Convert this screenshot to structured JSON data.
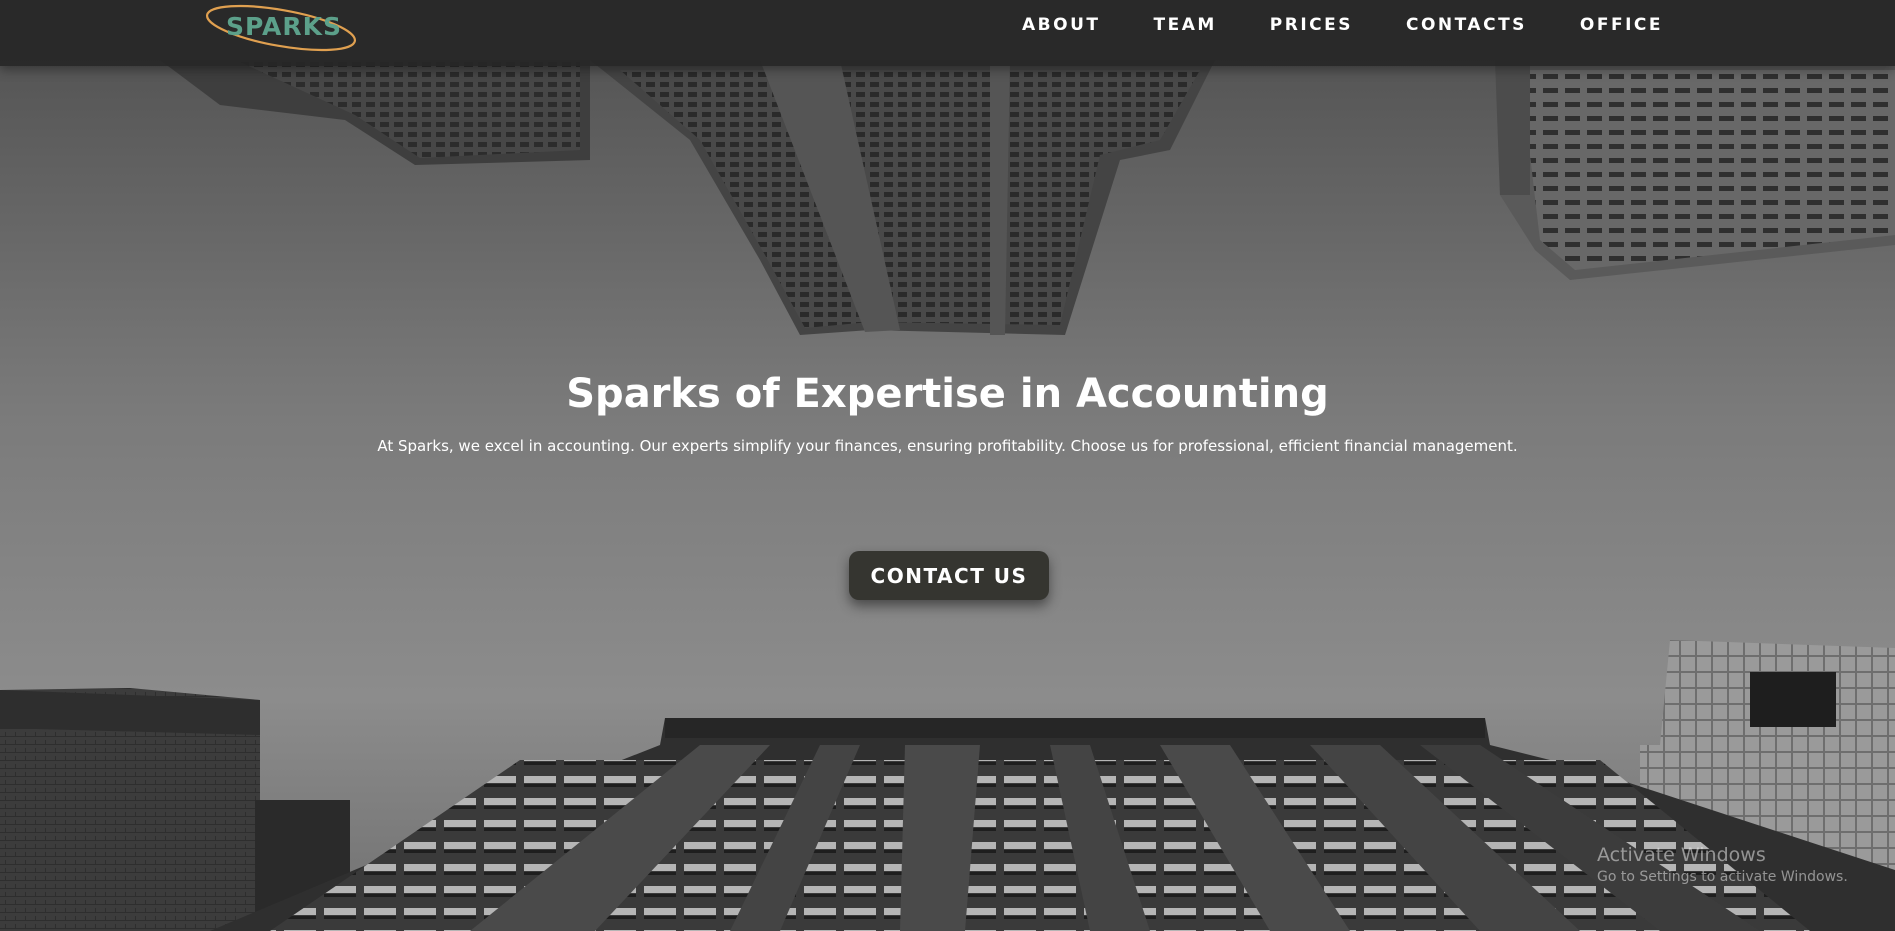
{
  "brand": {
    "logo_text": "SPARKS",
    "text_color": "#5ca08a",
    "swoosh_color": "#e0a050"
  },
  "nav": {
    "items": [
      {
        "label": "ABOUT"
      },
      {
        "label": "TEAM"
      },
      {
        "label": "PRICES"
      },
      {
        "label": "CONTACTS"
      },
      {
        "label": "OFFICE"
      }
    ]
  },
  "hero": {
    "title": "Sparks of Expertise in Accounting",
    "subtitle": "At Sparks, we excel in accounting. Our experts simplify your finances, ensuring profitability. Choose us for professional, efficient financial management.",
    "cta_label": "CONTACT US"
  },
  "os_watermark": {
    "title": "Activate Windows",
    "subtitle": "Go to Settings to activate Windows."
  },
  "colors": {
    "navbar_bg": "#262626",
    "button_bg": "#353530",
    "text": "#ffffff"
  }
}
